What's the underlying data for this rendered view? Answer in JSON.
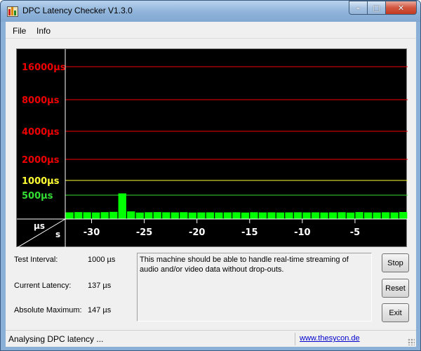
{
  "window": {
    "title": "DPC Latency Checker V1.3.0",
    "controls": {
      "minimize": "–",
      "maximize": "□",
      "close": "✕"
    }
  },
  "menu": {
    "items": [
      {
        "label": "File"
      },
      {
        "label": "Info"
      }
    ]
  },
  "chart_data": {
    "type": "bar",
    "y_labels": [
      {
        "text": "16000µs",
        "value": 16000,
        "color": "#ee0000"
      },
      {
        "text": "8000µs",
        "value": 8000,
        "color": "#ee0000"
      },
      {
        "text": "4000µs",
        "value": 4000,
        "color": "#ee0000"
      },
      {
        "text": "2000µs",
        "value": 2000,
        "color": "#ee0000"
      },
      {
        "text": "1000µs",
        "value": 1000,
        "color": "#ffff33"
      },
      {
        "text": "500µs",
        "value": 500,
        "color": "#33dd33"
      }
    ],
    "x_ticks": [
      "-30",
      "-25",
      "-20",
      "-15",
      "-10",
      "-5"
    ],
    "x_tick_values": [
      -30,
      -25,
      -20,
      -15,
      -10,
      -5
    ],
    "xlim": [
      -32.5,
      0
    ],
    "corner": {
      "y_unit": "µs",
      "x_unit": "s"
    },
    "bar_color": "#00ff00",
    "background": "#000000",
    "values": [
      140,
      145,
      142,
      138,
      144,
      150,
      560,
      160,
      136,
      142,
      145,
      141,
      139,
      143,
      136,
      138,
      140,
      137,
      139,
      141,
      136,
      142,
      138,
      140,
      137,
      139,
      141,
      138,
      140,
      137,
      139,
      142,
      136,
      145,
      139,
      137,
      141,
      138,
      147
    ]
  },
  "stats": {
    "test_interval": {
      "label": "Test Interval:",
      "value": "1000 µs"
    },
    "current_latency": {
      "label": "Current Latency:",
      "value": "137 µs"
    },
    "absolute_maximum": {
      "label": "Absolute Maximum:",
      "value": "147 µs"
    }
  },
  "message": "This machine should be able to handle real-time streaming of audio and/or video data without drop-outs.",
  "buttons": {
    "stop": "Stop",
    "reset": "Reset",
    "exit": "Exit"
  },
  "status": {
    "text": "Analysing DPC latency ...",
    "link": "www.thesycon.de"
  }
}
